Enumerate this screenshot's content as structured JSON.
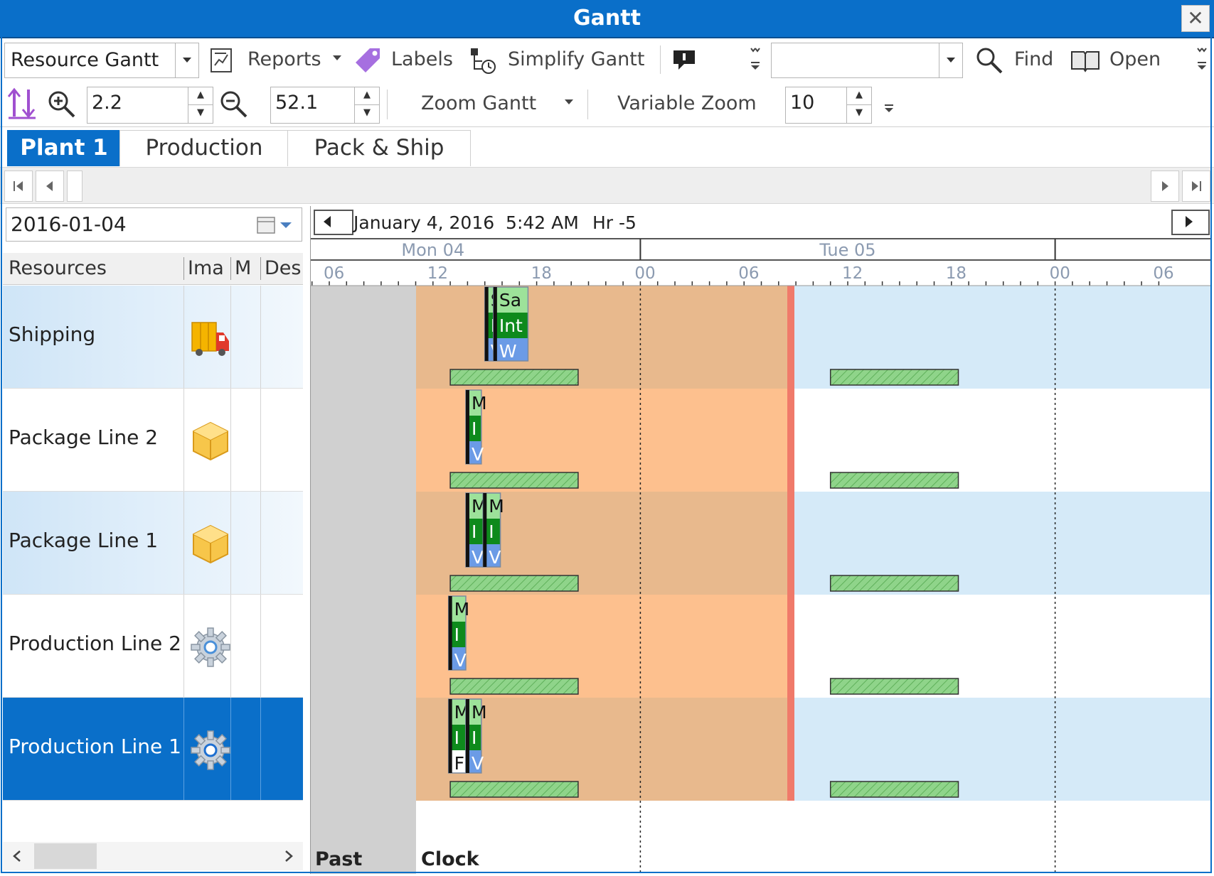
{
  "window": {
    "title": "Gantt",
    "close_glyph": "✕"
  },
  "toolbar1": {
    "view_select": "Resource Gantt",
    "reports_label": "Reports",
    "labels_label": "Labels",
    "simplify_label": "Simplify Gantt",
    "search_value": "",
    "find_label": "Find",
    "open_label": "Open"
  },
  "toolbar2": {
    "zoom_in_value": "2.2",
    "zoom_out_value": "52.1",
    "zoom_gantt_label": "Zoom Gantt",
    "variable_zoom_label": "Variable Zoom",
    "variable_zoom_value": "10"
  },
  "tabs": [
    {
      "label": "Plant 1",
      "active": true
    },
    {
      "label": "Production",
      "active": false
    },
    {
      "label": "Pack & Ship",
      "active": false
    }
  ],
  "date_picker": {
    "value": "2016-01-04"
  },
  "resource_grid": {
    "columns": [
      "Resources",
      "Ima",
      "M",
      "Des"
    ],
    "rows": [
      {
        "name": "Shipping",
        "icon": "truck-icon",
        "selected": false
      },
      {
        "name": "Package Line 2",
        "icon": "box-icon",
        "selected": false
      },
      {
        "name": "Package Line 1",
        "icon": "box-icon",
        "selected": false
      },
      {
        "name": "Production Line 2",
        "icon": "gear-icon",
        "selected": false
      },
      {
        "name": "Production Line 1",
        "icon": "gear-icon",
        "selected": true
      }
    ]
  },
  "gantt": {
    "clock_text": "January 4, 2016  5:42 AM",
    "timezone_text": "Hr -5",
    "days": [
      "Mon 04",
      "Tue 05"
    ],
    "hour_labels": [
      "06",
      "12",
      "18",
      "00",
      "06",
      "12",
      "18",
      "00",
      "06"
    ],
    "footer_past": "Past",
    "footer_clock": "Clock",
    "colors": {
      "past": "#d0d0d0",
      "frozen": "#fdc08e",
      "frozen_alt": "#e8b98d",
      "row_alt": "#d5eaf8",
      "red_line": "#f07a6a",
      "block_light": "#9de29a",
      "block_dark": "#0e8a1c",
      "block_blue": "#6b9be6",
      "calendar_bar": "#8fd48a"
    },
    "blocks": [
      {
        "row": 0,
        "labels": [
          "S",
          "I",
          "V"
        ],
        "bottom": "blue",
        "hour_start": 15.0,
        "hour_end": 15.5
      },
      {
        "row": 0,
        "labels": [
          "Sa",
          "Int",
          "W"
        ],
        "bottom": "blue",
        "hour_start": 15.5,
        "hour_end": 17.5
      },
      {
        "row": 1,
        "labels": [
          "M",
          "I",
          "V"
        ],
        "bottom": "blue",
        "hour_start": 13.9,
        "hour_end": 14.8
      },
      {
        "row": 2,
        "labels": [
          "M",
          "I",
          "V"
        ],
        "bottom": "blue",
        "hour_start": 13.9,
        "hour_end": 14.9
      },
      {
        "row": 2,
        "labels": [
          "M",
          "I",
          "V"
        ],
        "bottom": "blue",
        "hour_start": 14.9,
        "hour_end": 15.9
      },
      {
        "row": 3,
        "labels": [
          "M",
          "I",
          "V"
        ],
        "bottom": "blue",
        "hour_start": 12.9,
        "hour_end": 13.9
      },
      {
        "row": 4,
        "labels": [
          "M",
          "I",
          "F"
        ],
        "bottom": "white",
        "hour_start": 12.9,
        "hour_end": 13.9
      },
      {
        "row": 4,
        "labels": [
          "M",
          "I",
          "V"
        ],
        "bottom": "blue",
        "hour_start": 13.9,
        "hour_end": 14.8
      }
    ]
  }
}
